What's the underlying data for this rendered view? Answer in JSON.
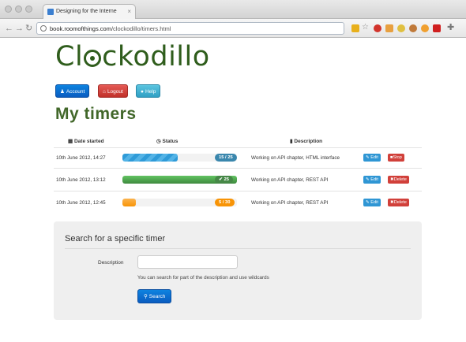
{
  "browser": {
    "tab_title": "Designing for the Interne",
    "tab_close": "×",
    "url_host": "book.roomofthings.com",
    "url_path": "/clockodillo/timers.html"
  },
  "app": {
    "logo_prefix": "Cl",
    "logo_suffix": "ckodillo"
  },
  "nav_buttons": [
    {
      "label": "Account",
      "icon": "user-icon",
      "glyph": "♟"
    },
    {
      "label": "Logout",
      "icon": "home-icon",
      "glyph": "⌂"
    },
    {
      "label": "Help",
      "icon": "info-icon",
      "glyph": "●"
    }
  ],
  "page_title": "My timers",
  "table": {
    "headers": [
      {
        "label": "Date started",
        "icon": "calendar-icon",
        "glyph": "▦"
      },
      {
        "label": "Status",
        "icon": "clock-icon",
        "glyph": "◷"
      },
      {
        "label": "Description",
        "icon": "book-icon",
        "glyph": "▮"
      }
    ],
    "rows": [
      {
        "date": "10th June 2012, 14:27",
        "progress": 0.48,
        "color": "blue",
        "badge": "15 / 25",
        "description": "Working on API chapter, HTML interface",
        "edit": "Edit",
        "action": "Stop",
        "action_icon": "stop-icon",
        "action_glyph": "■"
      },
      {
        "date": "10th June 2012, 13:12",
        "progress": 1.0,
        "color": "green",
        "badge": "✔ 25",
        "description": "Working on API chapter, REST API",
        "edit": "Edit",
        "action": "Delete",
        "action_icon": "delete-icon",
        "action_glyph": "✖"
      },
      {
        "date": "10th June 2012, 12:45",
        "progress": 0.12,
        "color": "orange",
        "badge": "5 / 30",
        "description": "Working on API chapter, REST API",
        "edit": "Edit",
        "action": "Delete",
        "action_icon": "delete-icon",
        "action_glyph": "✖"
      }
    ]
  },
  "search": {
    "title": "Search for a specific timer",
    "label": "Description",
    "value": "",
    "placeholder": "",
    "help": "You can search for part of the description and use wildcards",
    "button": "Search"
  },
  "colors": {
    "logo": "#2f5d1c",
    "title": "#416729",
    "primary": "#0a5cc0",
    "danger": "#c0302a",
    "info": "#2f9fc3"
  }
}
